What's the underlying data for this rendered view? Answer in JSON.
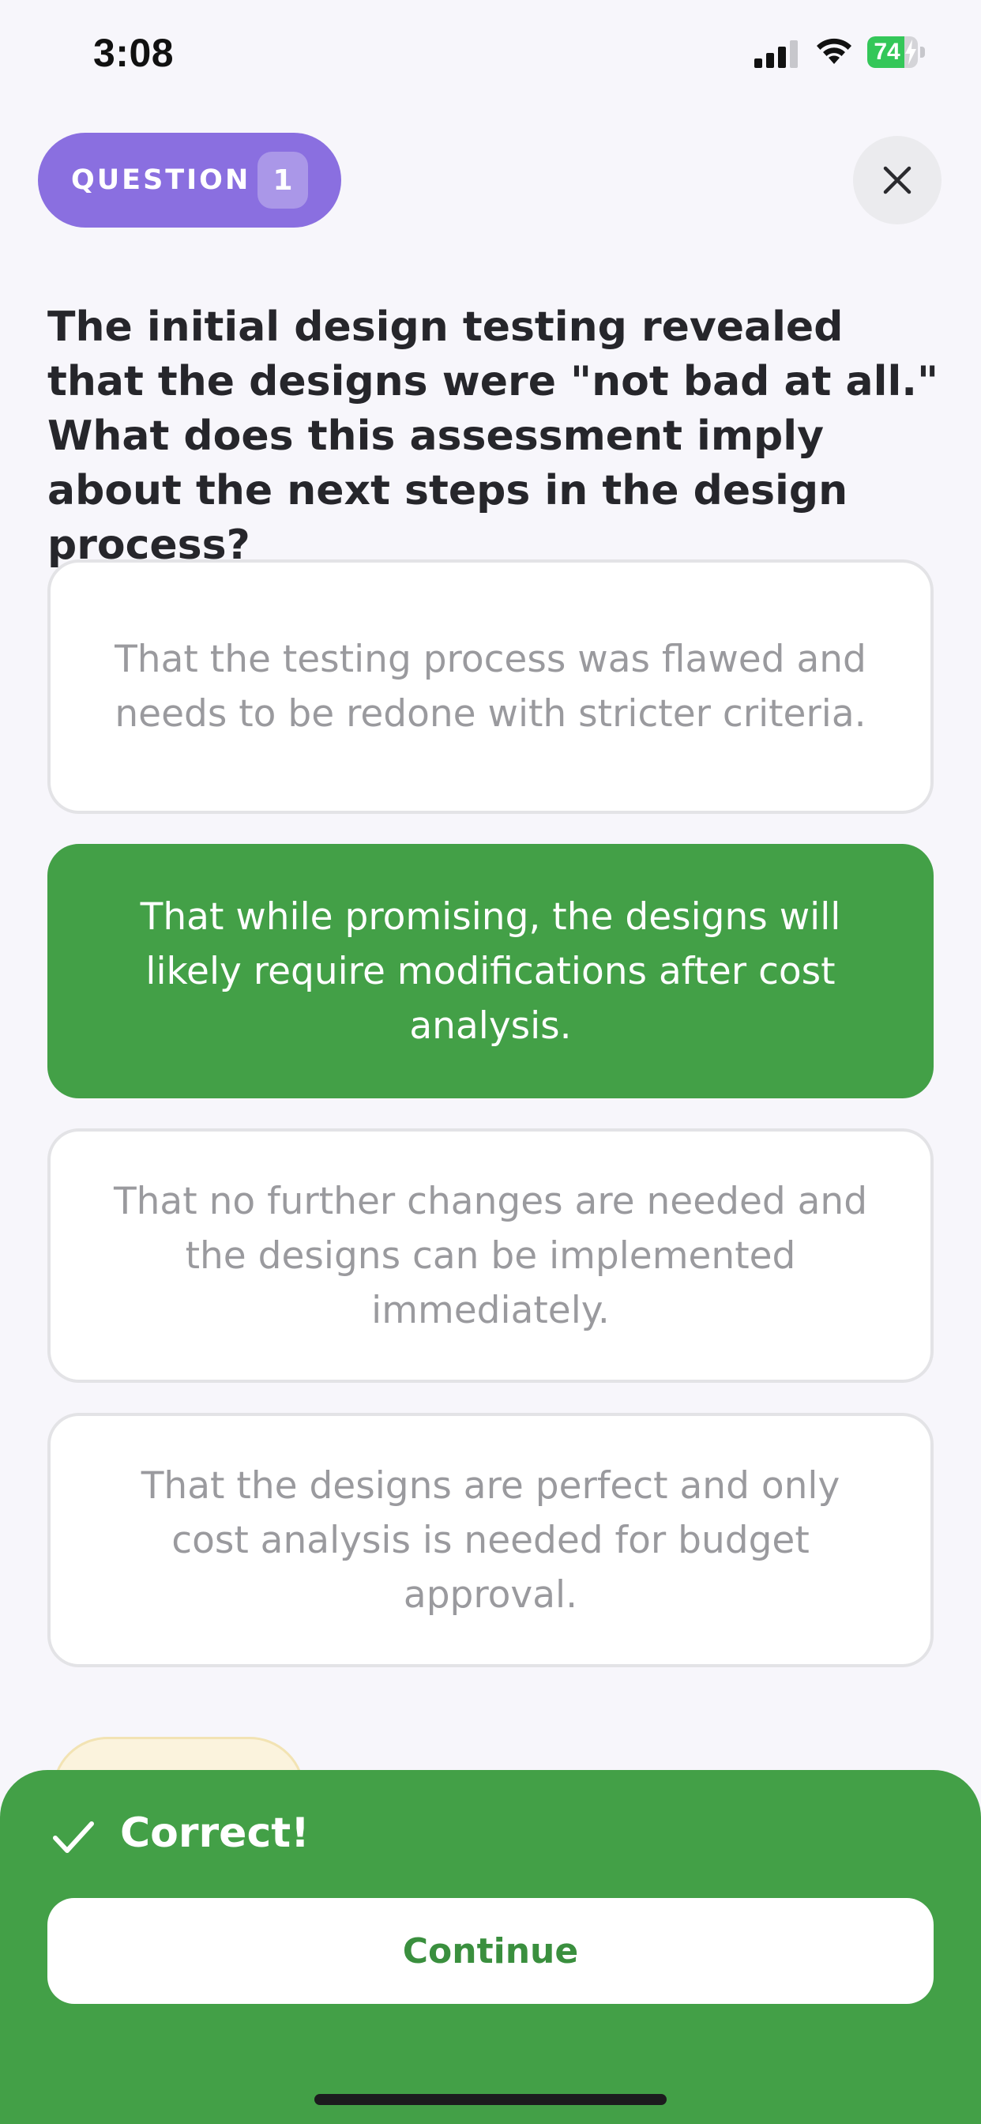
{
  "status_bar": {
    "time": "3:08",
    "battery_level": "74",
    "battery_percent": 74,
    "battery_color": "#34c759",
    "icons": [
      "signal-icon",
      "wifi-icon",
      "battery-icon",
      "charging-bolt-icon"
    ]
  },
  "header": {
    "question_label": "QUESTION",
    "question_number": "1",
    "close_icon": "close-icon"
  },
  "question": {
    "text": "The initial design testing revealed that the designs were \"not bad at all.\" What does this assessment imply about the next steps in the design process?"
  },
  "options": [
    {
      "text": "That the testing process was flawed and needs to be redone with stricter criteria.",
      "state": "default"
    },
    {
      "text": "That while promising, the designs will likely require modifications after cost analysis.",
      "state": "correct"
    },
    {
      "text": "That no further changes are needed and the designs can be implemented immediately.",
      "state": "default"
    },
    {
      "text": "That the designs are perfect and only cost analysis is needed for budget approval.",
      "state": "default"
    }
  ],
  "feedback": {
    "icon": "check-icon",
    "title": "Correct!",
    "continue_label": "Continue"
  },
  "colors": {
    "accent_purple": "#8a6fe0",
    "correct_green": "#43a047",
    "background": "#f7f6fb"
  }
}
